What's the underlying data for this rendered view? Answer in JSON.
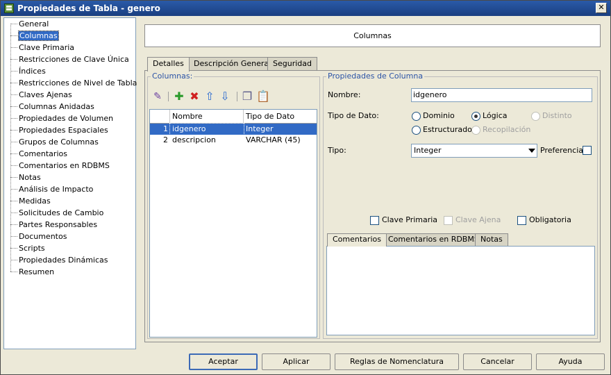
{
  "window": {
    "title": "Propiedades de Tabla - genero"
  },
  "sidebar": {
    "items": [
      {
        "label": "General"
      },
      {
        "label": "Columnas",
        "selected": true
      },
      {
        "label": "Clave Primaria"
      },
      {
        "label": "Restricciones de Clave Única"
      },
      {
        "label": "Índices"
      },
      {
        "label": "Restricciones de Nivel de Tabla"
      },
      {
        "label": "Claves Ajenas"
      },
      {
        "label": "Columnas Anidadas"
      },
      {
        "label": "Propiedades de Volumen"
      },
      {
        "label": "Propiedades Espaciales"
      },
      {
        "label": "Grupos de Columnas"
      },
      {
        "label": "Comentarios"
      },
      {
        "label": "Comentarios en RDBMS"
      },
      {
        "label": "Notas"
      },
      {
        "label": "Análisis de Impacto"
      },
      {
        "label": "Medidas"
      },
      {
        "label": "Solicitudes de Cambio"
      },
      {
        "label": "Partes Responsables"
      },
      {
        "label": "Documentos"
      },
      {
        "label": "Scripts"
      },
      {
        "label": "Propiedades Dinámicas"
      },
      {
        "label": "Resumen"
      }
    ]
  },
  "header": {
    "title": "Columnas"
  },
  "tabs": [
    {
      "label": "Detalles",
      "active": true
    },
    {
      "label": "Descripción General"
    },
    {
      "label": "Seguridad"
    }
  ],
  "columns_panel": {
    "title": "Columnas:",
    "toolbar": [
      "edit-icon",
      "add-icon",
      "delete-icon",
      "move-up-icon",
      "move-down-icon",
      "copy-icon",
      "paste-icon"
    ],
    "table": {
      "headers": [
        "Nombre",
        "Tipo de Dato"
      ],
      "rows": [
        {
          "num": "1",
          "name": "idgenero",
          "type": "Integer",
          "selected": true
        },
        {
          "num": "2",
          "name": "descripcion",
          "type": "VARCHAR (45)"
        }
      ]
    }
  },
  "properties": {
    "title": "Propiedades de Columna",
    "nombre_label": "Nombre:",
    "nombre_value": "idgenero",
    "tipo_dato_label": "Tipo de Dato:",
    "radios": {
      "dominio": "Dominio",
      "logica": "Lógica",
      "distinto": "Distinto",
      "estructurado": "Estructurado",
      "recopilacion": "Recopilación",
      "selected": "logica"
    },
    "tipo_label": "Tipo:",
    "tipo_value": "Integer",
    "preferencia_label": "Preferencia",
    "clave_primaria": "Clave Primaria",
    "clave_ajena": "Clave Ajena",
    "obligatoria": "Obligatoria"
  },
  "subtabs": [
    {
      "label": "Comentarios",
      "active": true
    },
    {
      "label": "Comentarios en RDBMS"
    },
    {
      "label": "Notas"
    }
  ],
  "buttons": {
    "aceptar": "Aceptar",
    "aplicar": "Aplicar",
    "reglas": "Reglas de Nomenclatura",
    "cancelar": "Cancelar",
    "ayuda": "Ayuda"
  },
  "colors": {
    "titlebar": "#1a3f80",
    "selection": "#316ac5",
    "group_title": "#2b53a6"
  }
}
